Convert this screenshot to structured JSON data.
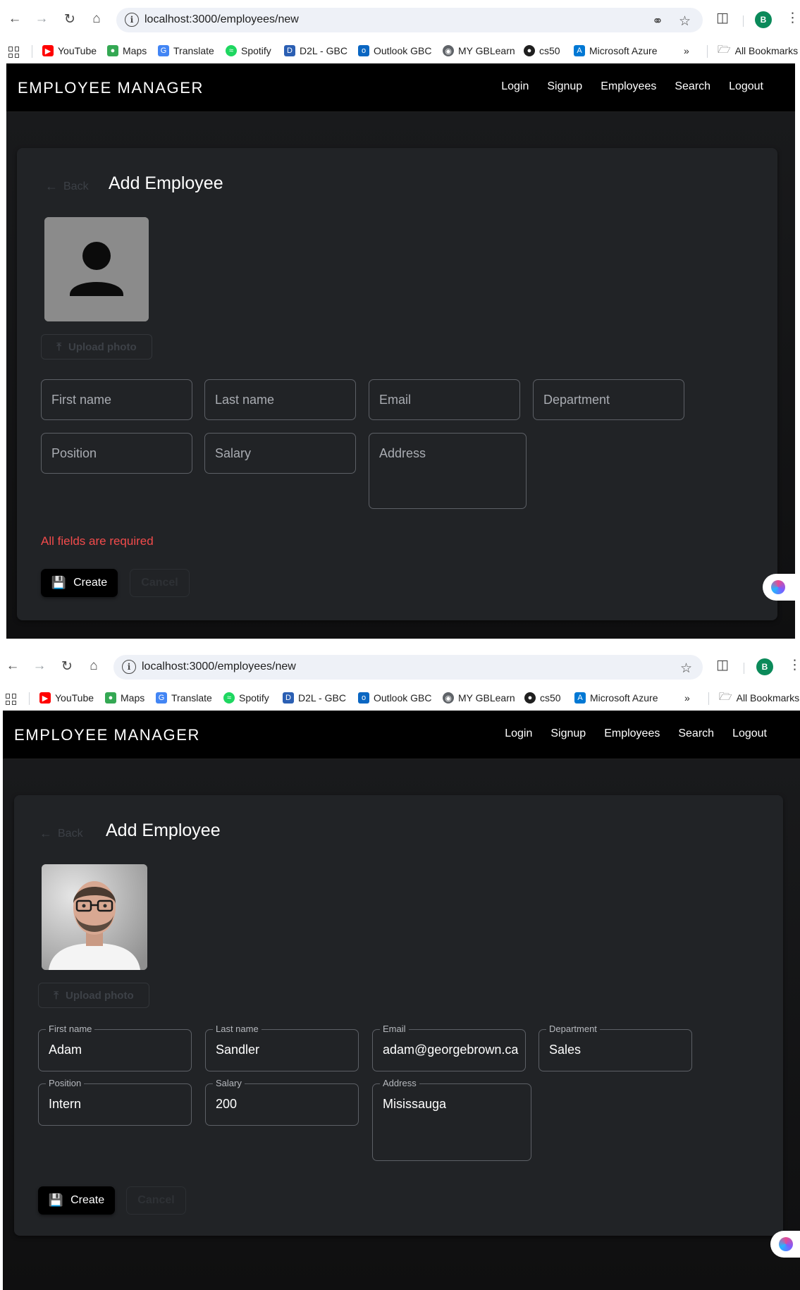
{
  "browser": {
    "url": "localhost:3000/employees/new",
    "avatar_letter": "B",
    "bookmarks": [
      "YouTube",
      "Maps",
      "Translate",
      "Spotify",
      "D2L - GBC",
      "Outlook GBC",
      "MY GBLearn",
      "cs50",
      "Microsoft Azure"
    ],
    "more": "»",
    "all_bookmarks": "All Bookmarks"
  },
  "app": {
    "brand": "EMPLOYEE MANAGER",
    "nav": [
      "Login",
      "Signup",
      "Employees",
      "Search",
      "Logout"
    ],
    "back_label": "Back",
    "page_title": "Add Employee",
    "upload_label": "Upload photo",
    "create_label": "Create",
    "cancel_label": "Cancel"
  },
  "form_empty": {
    "first_name": "First name",
    "last_name": "Last name",
    "email": "Email",
    "department": "Department",
    "position": "Position",
    "salary": "Salary",
    "address": "Address",
    "error": "All fields are required"
  },
  "form_filled": {
    "first_name_label": "First name",
    "first_name": "Adam",
    "last_name_label": "Last name",
    "last_name": "Sandler",
    "email_label": "Email",
    "email": "adam@georgebrown.ca",
    "department_label": "Department",
    "department": "Sales",
    "position_label": "Position",
    "position": "Intern",
    "salary_label": "Salary",
    "salary": "200",
    "address_label": "Address",
    "address": "Misissauga"
  },
  "colors": {
    "error": "#f24b4b",
    "card": "#212326",
    "appbar": "#000000"
  }
}
